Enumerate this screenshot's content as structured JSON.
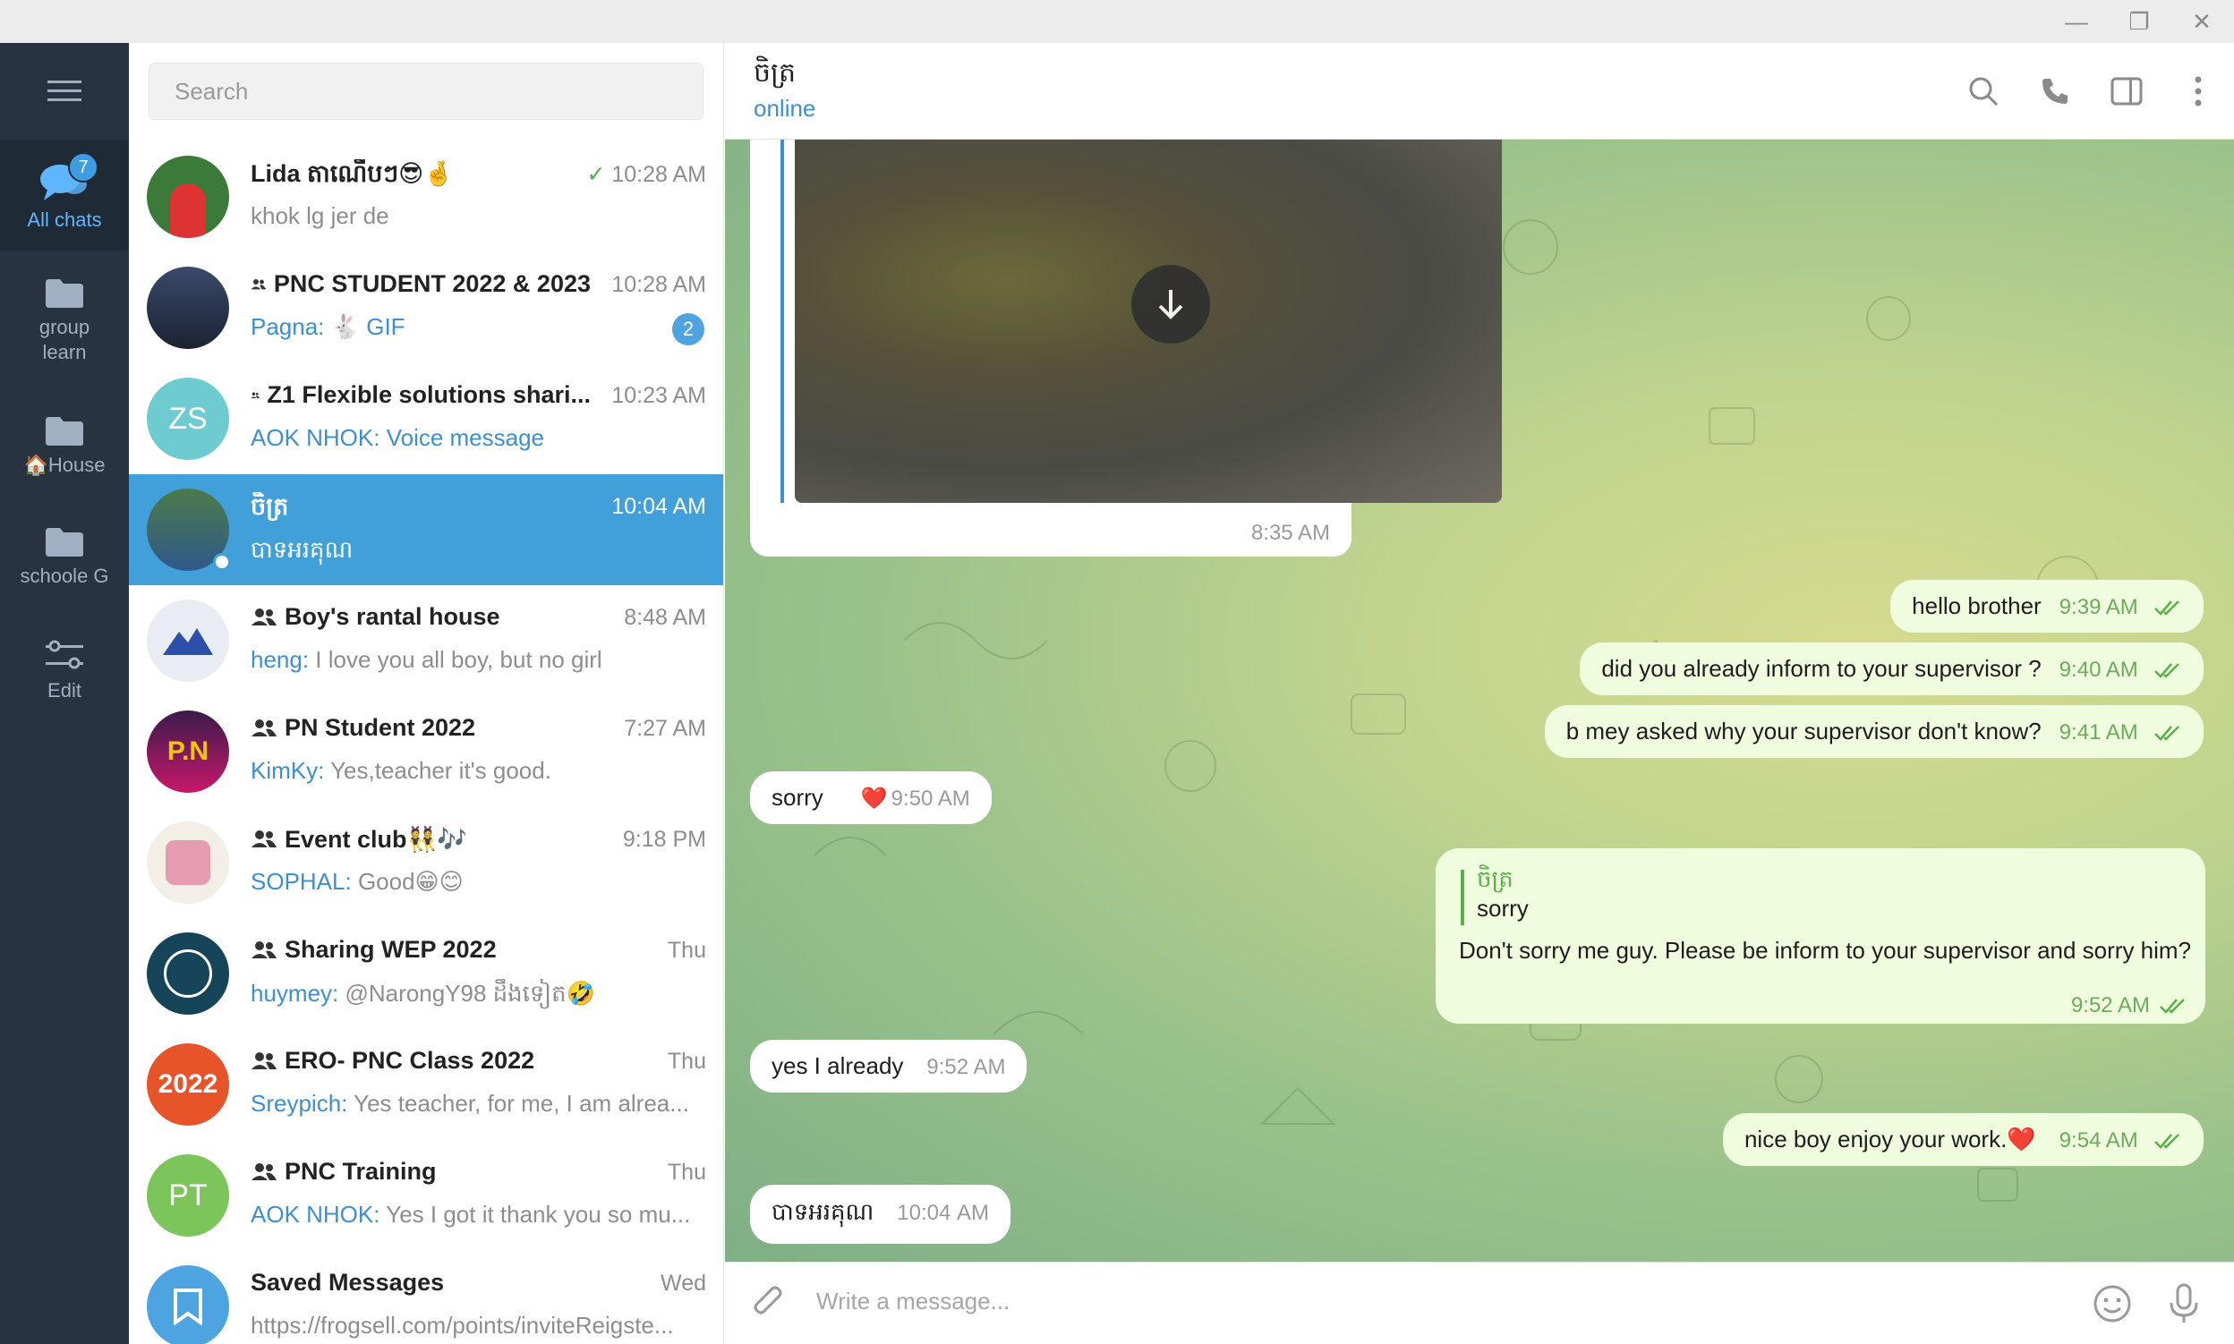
{
  "window": {
    "minimize": "—",
    "restore": "❐",
    "close": "✕"
  },
  "folders": {
    "all_chats": {
      "label": "All chats",
      "badge": "7"
    },
    "items": [
      {
        "label": "group learn"
      },
      {
        "label": "House"
      },
      {
        "label": "schoole G"
      },
      {
        "label": "Edit"
      }
    ]
  },
  "search": {
    "placeholder": "Search"
  },
  "chats": [
    {
      "title": "Lida តាណើបៗ😎🤞",
      "time": "10:28 AM",
      "preview": "khok lg jer de",
      "sender": "",
      "group": false
    },
    {
      "title": "PNC STUDENT 2022 & 2023",
      "time": "10:28 AM",
      "sender": "Pagna:",
      "preview": " 🐇 GIF",
      "unread": "2",
      "group": true
    },
    {
      "title": "Z1 Flexible solutions shari...",
      "time": "10:23 AM",
      "sender": "AOK NHOK: Voice message",
      "preview": "",
      "avatar_text": "ZS",
      "group": true
    },
    {
      "title": "ចិត្រ",
      "time": "10:04 AM",
      "sender": "",
      "preview": "បាទអរគុណ",
      "group": false
    },
    {
      "title": "Boy's rantal house",
      "time": "8:48 AM",
      "sender": "heng:",
      "preview": " I love you all boy, but no girl",
      "group": true
    },
    {
      "title": "PN Student 2022",
      "time": "7:27 AM",
      "sender": "KimKy:",
      "preview": " Yes,teacher it's good.",
      "group": true
    },
    {
      "title": "Event club👯🎶",
      "time": "9:18 PM",
      "sender": "SOPHAL:",
      "preview": " Good😁😊",
      "group": true
    },
    {
      "title": "Sharing WEP 2022",
      "time": "Thu",
      "sender": "huymey:",
      "preview": " @NarongY98 ដឹងទៀត🤣",
      "group": true
    },
    {
      "title": "ERO- PNC Class 2022",
      "time": "Thu",
      "sender": "Sreypich:",
      "preview": " Yes teacher, for me, I am alrea...",
      "group": true
    },
    {
      "title": "PNC Training",
      "time": "Thu",
      "sender": "AOK NHOK:",
      "preview": " Yes I got it thank you so mu...",
      "avatar_text": "PT",
      "group": true
    },
    {
      "title": "Saved Messages",
      "time": "Wed",
      "sender": "",
      "preview": "https://frogsell.com/points/inviteReigste...",
      "group": false
    }
  ],
  "header": {
    "name": "ចិត្រ",
    "status": "online"
  },
  "messages": {
    "media_time": "8:35 AM",
    "m1": {
      "text": "hello brother",
      "time": "9:39 AM"
    },
    "m2": {
      "text": "did you already inform to your supervisor ?",
      "time": "9:40 AM"
    },
    "m3": {
      "text": "b mey asked why your supervisor don't know?",
      "time": "9:41 AM"
    },
    "m4": {
      "text": "sorry",
      "reaction": "❤️",
      "time": "9:50 AM"
    },
    "m5": {
      "reply_name": "ចិត្រ",
      "reply_text": "sorry",
      "text": "Don't sorry me guy. Please be inform to your supervisor and sorry him?",
      "time": "9:52 AM"
    },
    "m6": {
      "text": "yes I already",
      "time": "9:52 AM"
    },
    "m7": {
      "text": "nice boy enjoy your work.❤️",
      "time": "9:54 AM"
    },
    "m8": {
      "text": "បាទអរគុណ",
      "time": "10:04 AM"
    }
  },
  "composer": {
    "placeholder": "Write a message..."
  },
  "colors": {
    "accent": "#419fd9",
    "sidebar": "#283341",
    "out_bubble": "#effdde",
    "tick": "#5bb04a"
  }
}
